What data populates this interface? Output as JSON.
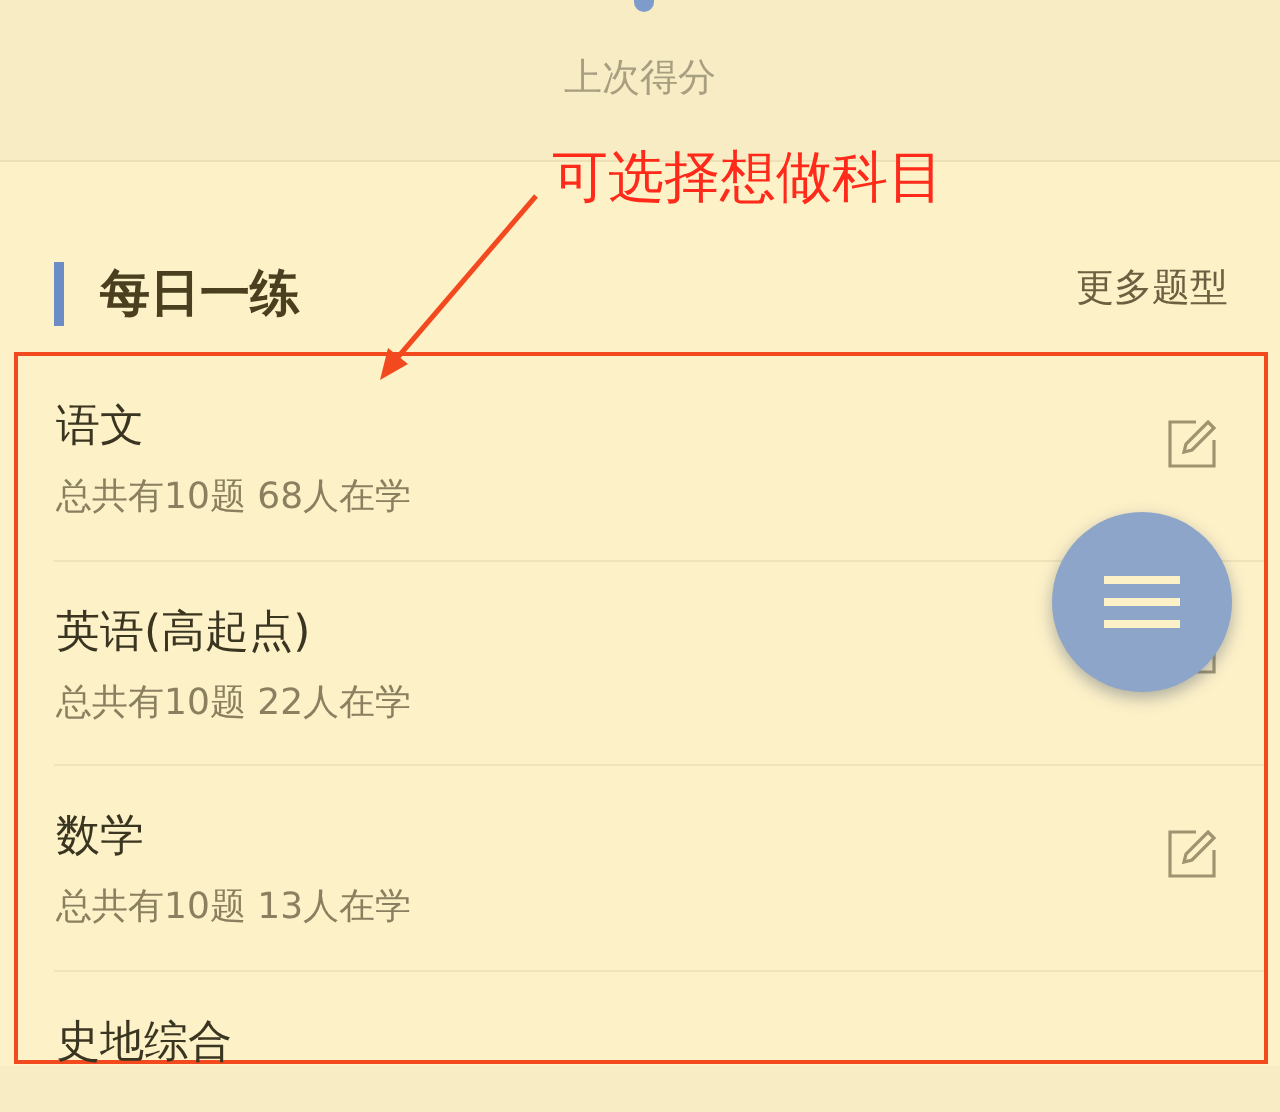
{
  "score": {
    "label": "上次得分"
  },
  "annotation": {
    "text": "可选择想做科目"
  },
  "section": {
    "title": "每日一练",
    "more_link": "更多题型"
  },
  "subjects": [
    {
      "name": "语文",
      "summary": "总共有10题 68人在学"
    },
    {
      "name": "英语(高起点)",
      "summary": "总共有10题 22人在学"
    },
    {
      "name": "数学",
      "summary": "总共有10题 13人在学"
    },
    {
      "name": "史地综合"
    }
  ]
}
